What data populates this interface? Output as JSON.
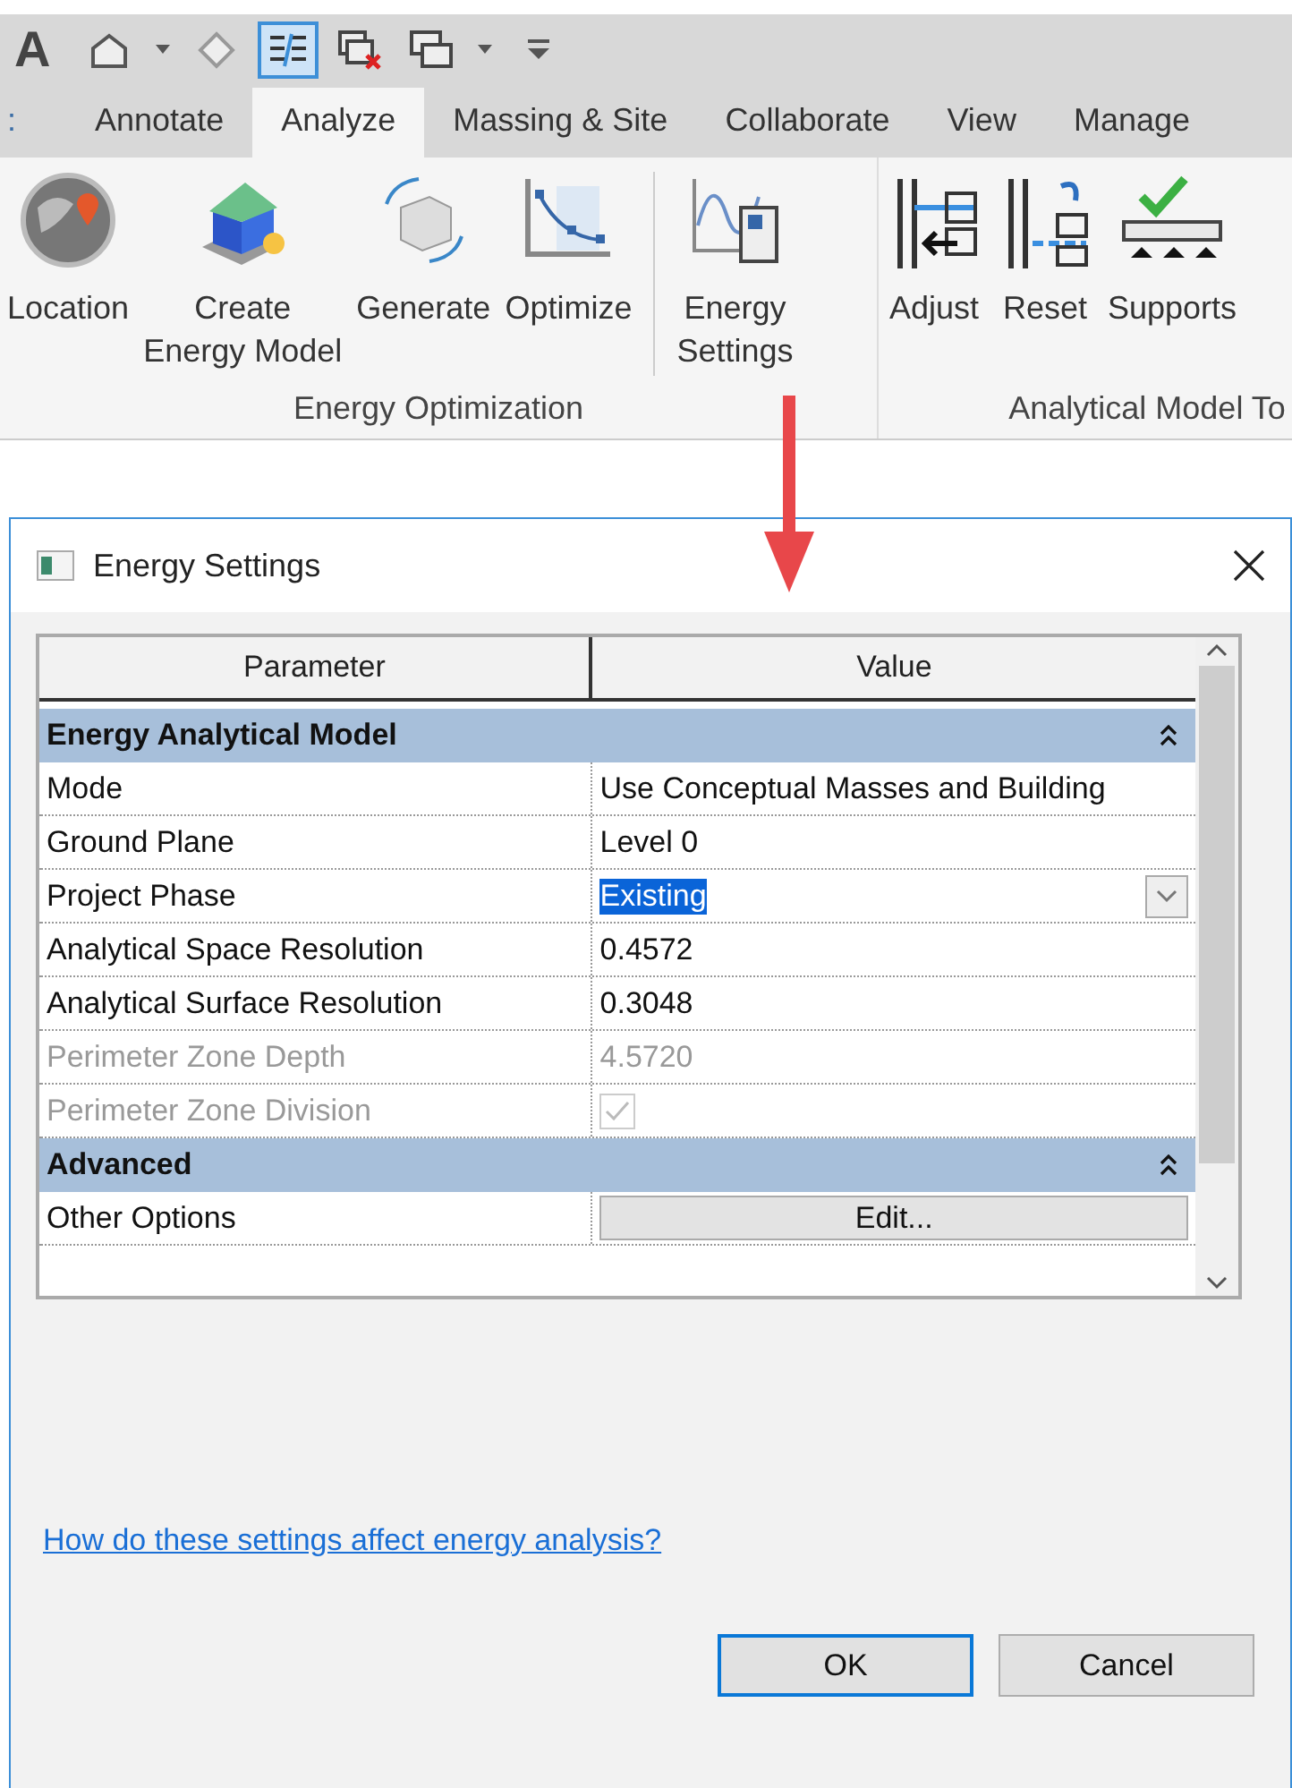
{
  "quick_access": {
    "app_letter": "A",
    "tools": [
      {
        "on": false
      },
      {
        "on": false
      },
      {
        "on": false
      },
      {
        "on": true
      },
      {
        "on": false
      },
      {
        "on": false
      },
      {
        "on": false
      },
      {
        "on": false
      }
    ]
  },
  "tab_edge": ":",
  "tabs": [
    {
      "label": "Annotate",
      "selected": false
    },
    {
      "label": "Analyze",
      "selected": true
    },
    {
      "label": "Massing & Site",
      "selected": false
    },
    {
      "label": "Collaborate",
      "selected": false
    },
    {
      "label": "View",
      "selected": false
    },
    {
      "label": "Manage",
      "selected": false
    }
  ],
  "panels": [
    {
      "title": "Energy Optimization",
      "buttons": [
        {
          "lines": [
            "Location"
          ]
        },
        {
          "lines": [
            "Create",
            "Energy Model"
          ]
        },
        {
          "lines": [
            "Generate"
          ]
        },
        {
          "lines": [
            "Optimize"
          ]
        },
        {
          "lines": [
            "Energy",
            "Settings"
          ],
          "separated": true
        }
      ]
    },
    {
      "title": "Analytical Model To",
      "buttons": [
        {
          "lines": [
            "Adjust"
          ]
        },
        {
          "lines": [
            "Reset"
          ]
        },
        {
          "lines": [
            "Supports"
          ]
        }
      ]
    }
  ],
  "dialog": {
    "title": "Energy Settings",
    "columns": [
      "Parameter",
      "Value"
    ],
    "rows": [
      {
        "kind": "group",
        "label": "Energy Analytical Model",
        "expanded": true
      },
      {
        "kind": "text",
        "label": "Mode",
        "value": "Use Conceptual Masses and Building",
        "disabled": false,
        "selected": false
      },
      {
        "kind": "text",
        "label": "Ground Plane",
        "value": "Level 0",
        "disabled": false,
        "selected": false
      },
      {
        "kind": "dropdown",
        "label": "Project Phase",
        "value": "Existing",
        "disabled": false,
        "selected": true
      },
      {
        "kind": "text",
        "label": "Analytical Space Resolution",
        "value": "0.4572",
        "disabled": false,
        "selected": false
      },
      {
        "kind": "text",
        "label": "Analytical Surface Resolution",
        "value": "0.3048",
        "disabled": false,
        "selected": false
      },
      {
        "kind": "text",
        "label": "Perimeter Zone Depth",
        "value": "4.5720",
        "disabled": true,
        "selected": false
      },
      {
        "kind": "checkbox",
        "label": "Perimeter Zone Division",
        "checked": true,
        "disabled": true,
        "selected": false
      },
      {
        "kind": "group",
        "label": "Advanced",
        "expanded": true
      },
      {
        "kind": "button",
        "label": "Other Options",
        "value": "Edit...",
        "disabled": false,
        "selected": false
      }
    ],
    "link": "How do these settings affect energy analysis?",
    "buttons": [
      {
        "label": "OK",
        "default": true
      },
      {
        "label": "Cancel",
        "default": false
      }
    ]
  }
}
